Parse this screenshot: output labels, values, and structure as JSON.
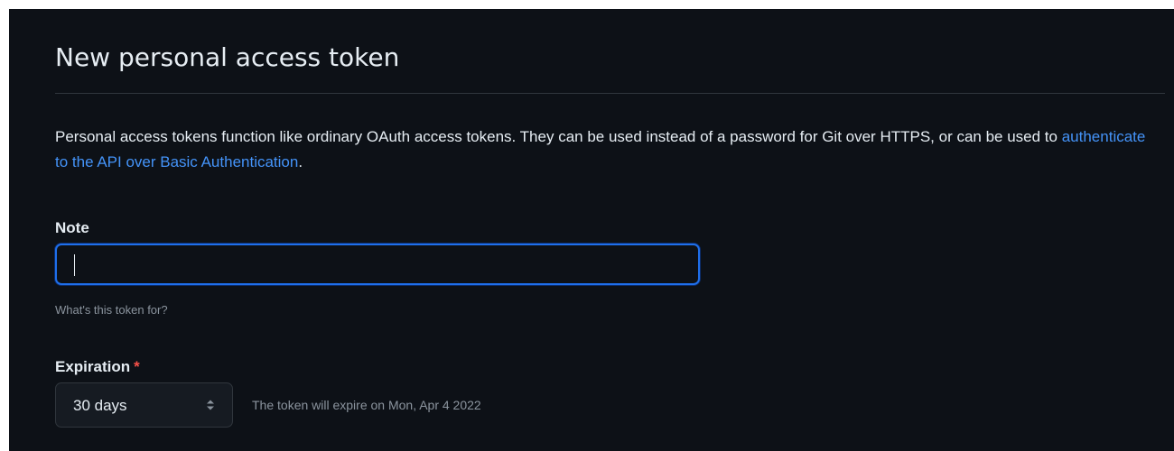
{
  "header": {
    "title": "New personal access token"
  },
  "intro": {
    "text_before": "Personal access tokens function like ordinary OAuth access tokens. They can be used instead of a password for Git over HTTPS, or can be used to ",
    "link_text": "authenticate to the API over Basic Authentication",
    "text_after": "."
  },
  "note_field": {
    "label": "Note",
    "value": "",
    "hint": "What's this token for?"
  },
  "expiration_field": {
    "label": "Expiration",
    "required_mark": "*",
    "selected_option": "30 days",
    "expiry_message": "The token will expire on Mon, Apr 4 2022"
  },
  "icons": {
    "select_arrows": "chevron-up-down-icon"
  },
  "colors": {
    "background": "#0d1117",
    "text": "#e6edf3",
    "muted_text": "#8b949e",
    "link": "#4493f8",
    "focus_border": "#1f6feb",
    "required": "#f85149",
    "border": "#30363d"
  }
}
